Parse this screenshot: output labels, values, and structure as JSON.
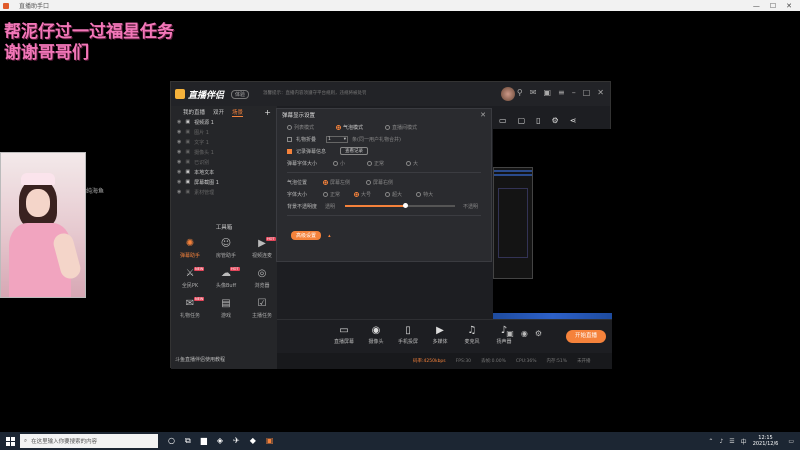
{
  "window": {
    "title": "直播助手口"
  },
  "promo": {
    "line1": "帮泥仔过一过福星任务",
    "line2": "谢谢哥哥们"
  },
  "thumb": {
    "label": "纯海鱼"
  },
  "app": {
    "name": "直播伴侣",
    "version": "体验",
    "tips": "温馨提示：直播内容须遵守平台规则，违规将被处罚",
    "left_tabs": [
      "我的直播",
      "双开",
      "场景"
    ],
    "scenes": [
      {
        "label": "视频源 1",
        "dim": false
      },
      {
        "label": "图片 1",
        "dim": true
      },
      {
        "label": "文字 1",
        "dim": true
      },
      {
        "label": "摄像头 1",
        "dim": true
      },
      {
        "label": "已识别",
        "dim": true
      },
      {
        "label": "本地文本",
        "dim": false
      },
      {
        "label": "屏幕截图 1",
        "dim": false
      },
      {
        "label": "素材管理",
        "dim": true
      }
    ],
    "toolbox_title": "工具箱",
    "tools": [
      {
        "label": "弹幕助手",
        "icon": "danmu-icon",
        "on": true,
        "badge": ""
      },
      {
        "label": "房管助手",
        "icon": "user-icon",
        "on": false,
        "badge": ""
      },
      {
        "label": "视频连麦",
        "icon": "video-icon",
        "on": false,
        "badge": "HOT"
      },
      {
        "label": "全民PK",
        "icon": "pk-icon",
        "on": false,
        "badge": "NEW"
      },
      {
        "label": "头像Buff",
        "icon": "buff-icon",
        "on": false,
        "badge": "HOT"
      },
      {
        "label": "浏览器",
        "icon": "browser-icon",
        "on": false,
        "badge": ""
      },
      {
        "label": "礼物任务",
        "icon": "gift-icon",
        "on": false,
        "badge": "NEW"
      },
      {
        "label": "游戏",
        "icon": "game-icon",
        "on": false,
        "badge": ""
      },
      {
        "label": "主播任务",
        "icon": "task-icon",
        "on": false,
        "badge": ""
      }
    ],
    "footnote": "斗鱼直播伴侣使用教程",
    "bottom_buttons": [
      {
        "label": "直播屏幕",
        "icon": "screen-icon"
      },
      {
        "label": "摄像头",
        "icon": "camera-icon"
      },
      {
        "label": "手机投屏",
        "icon": "phone-icon"
      },
      {
        "label": "多媒体",
        "icon": "media-icon"
      },
      {
        "label": "麦克风",
        "icon": "mic-icon"
      },
      {
        "label": "扬声器",
        "icon": "speaker-icon"
      }
    ],
    "start_label": "开始直播",
    "status": [
      "码率:4250kbps",
      "FPS:30",
      "丢帧:0.00%",
      "CPU:36%",
      "内存:51%",
      "未开播"
    ]
  },
  "dialog": {
    "title": "弹幕显示设置",
    "modes": [
      {
        "label": "列表模式",
        "on": false
      },
      {
        "label": "气泡模式",
        "on": true
      },
      {
        "label": "直播间模式",
        "on": false
      }
    ],
    "auto_hide": {
      "label": "礼物折叠",
      "on": false,
      "value": "1",
      "hint": "条(同一用户礼物合并)"
    },
    "record": {
      "label": "记录弹幕信息",
      "on": true,
      "button": "查看记录"
    },
    "size_label": "弹幕字体大小",
    "sizes": [
      "小",
      "正常",
      "大"
    ],
    "pos_label": "气泡位置",
    "positions": [
      "屏幕左侧",
      "屏幕右侧"
    ],
    "font_label": "字体大小",
    "fonts": [
      "正常",
      "大号",
      "超大",
      "特大"
    ],
    "opacity_label": "背景不透明度",
    "opacity_left": "透明",
    "opacity_right": "不透明",
    "opacity_value": 0.55,
    "advanced": "高级设置"
  },
  "taskbar": {
    "search_placeholder": "在这里输入你要搜索的内容",
    "time": "12:15",
    "date": "2021/12/6"
  },
  "colors": {
    "accent": "#f5823b",
    "promo": "#f277b8"
  }
}
